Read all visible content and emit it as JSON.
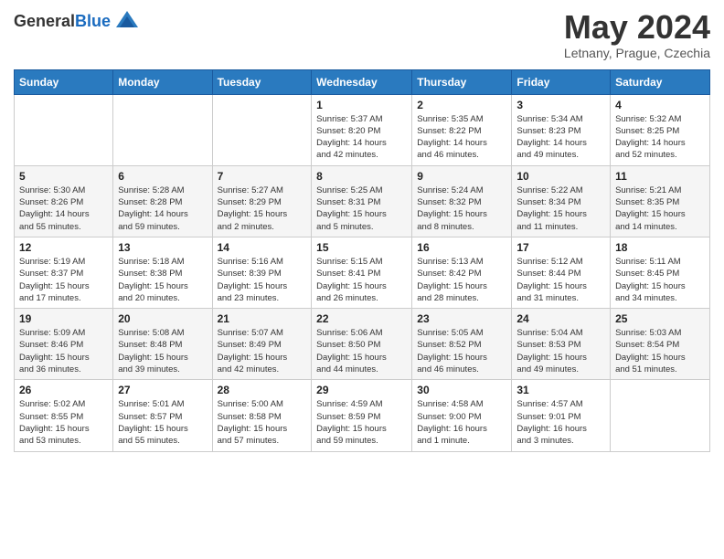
{
  "header": {
    "logo_line1": "General",
    "logo_line2": "Blue",
    "month_title": "May 2024",
    "location": "Letnany, Prague, Czechia"
  },
  "calendar": {
    "days_of_week": [
      "Sunday",
      "Monday",
      "Tuesday",
      "Wednesday",
      "Thursday",
      "Friday",
      "Saturday"
    ],
    "weeks": [
      [
        {
          "day": "",
          "info": ""
        },
        {
          "day": "",
          "info": ""
        },
        {
          "day": "",
          "info": ""
        },
        {
          "day": "1",
          "info": "Sunrise: 5:37 AM\nSunset: 8:20 PM\nDaylight: 14 hours\nand 42 minutes."
        },
        {
          "day": "2",
          "info": "Sunrise: 5:35 AM\nSunset: 8:22 PM\nDaylight: 14 hours\nand 46 minutes."
        },
        {
          "day": "3",
          "info": "Sunrise: 5:34 AM\nSunset: 8:23 PM\nDaylight: 14 hours\nand 49 minutes."
        },
        {
          "day": "4",
          "info": "Sunrise: 5:32 AM\nSunset: 8:25 PM\nDaylight: 14 hours\nand 52 minutes."
        }
      ],
      [
        {
          "day": "5",
          "info": "Sunrise: 5:30 AM\nSunset: 8:26 PM\nDaylight: 14 hours\nand 55 minutes."
        },
        {
          "day": "6",
          "info": "Sunrise: 5:28 AM\nSunset: 8:28 PM\nDaylight: 14 hours\nand 59 minutes."
        },
        {
          "day": "7",
          "info": "Sunrise: 5:27 AM\nSunset: 8:29 PM\nDaylight: 15 hours\nand 2 minutes."
        },
        {
          "day": "8",
          "info": "Sunrise: 5:25 AM\nSunset: 8:31 PM\nDaylight: 15 hours\nand 5 minutes."
        },
        {
          "day": "9",
          "info": "Sunrise: 5:24 AM\nSunset: 8:32 PM\nDaylight: 15 hours\nand 8 minutes."
        },
        {
          "day": "10",
          "info": "Sunrise: 5:22 AM\nSunset: 8:34 PM\nDaylight: 15 hours\nand 11 minutes."
        },
        {
          "day": "11",
          "info": "Sunrise: 5:21 AM\nSunset: 8:35 PM\nDaylight: 15 hours\nand 14 minutes."
        }
      ],
      [
        {
          "day": "12",
          "info": "Sunrise: 5:19 AM\nSunset: 8:37 PM\nDaylight: 15 hours\nand 17 minutes."
        },
        {
          "day": "13",
          "info": "Sunrise: 5:18 AM\nSunset: 8:38 PM\nDaylight: 15 hours\nand 20 minutes."
        },
        {
          "day": "14",
          "info": "Sunrise: 5:16 AM\nSunset: 8:39 PM\nDaylight: 15 hours\nand 23 minutes."
        },
        {
          "day": "15",
          "info": "Sunrise: 5:15 AM\nSunset: 8:41 PM\nDaylight: 15 hours\nand 26 minutes."
        },
        {
          "day": "16",
          "info": "Sunrise: 5:13 AM\nSunset: 8:42 PM\nDaylight: 15 hours\nand 28 minutes."
        },
        {
          "day": "17",
          "info": "Sunrise: 5:12 AM\nSunset: 8:44 PM\nDaylight: 15 hours\nand 31 minutes."
        },
        {
          "day": "18",
          "info": "Sunrise: 5:11 AM\nSunset: 8:45 PM\nDaylight: 15 hours\nand 34 minutes."
        }
      ],
      [
        {
          "day": "19",
          "info": "Sunrise: 5:09 AM\nSunset: 8:46 PM\nDaylight: 15 hours\nand 36 minutes."
        },
        {
          "day": "20",
          "info": "Sunrise: 5:08 AM\nSunset: 8:48 PM\nDaylight: 15 hours\nand 39 minutes."
        },
        {
          "day": "21",
          "info": "Sunrise: 5:07 AM\nSunset: 8:49 PM\nDaylight: 15 hours\nand 42 minutes."
        },
        {
          "day": "22",
          "info": "Sunrise: 5:06 AM\nSunset: 8:50 PM\nDaylight: 15 hours\nand 44 minutes."
        },
        {
          "day": "23",
          "info": "Sunrise: 5:05 AM\nSunset: 8:52 PM\nDaylight: 15 hours\nand 46 minutes."
        },
        {
          "day": "24",
          "info": "Sunrise: 5:04 AM\nSunset: 8:53 PM\nDaylight: 15 hours\nand 49 minutes."
        },
        {
          "day": "25",
          "info": "Sunrise: 5:03 AM\nSunset: 8:54 PM\nDaylight: 15 hours\nand 51 minutes."
        }
      ],
      [
        {
          "day": "26",
          "info": "Sunrise: 5:02 AM\nSunset: 8:55 PM\nDaylight: 15 hours\nand 53 minutes."
        },
        {
          "day": "27",
          "info": "Sunrise: 5:01 AM\nSunset: 8:57 PM\nDaylight: 15 hours\nand 55 minutes."
        },
        {
          "day": "28",
          "info": "Sunrise: 5:00 AM\nSunset: 8:58 PM\nDaylight: 15 hours\nand 57 minutes."
        },
        {
          "day": "29",
          "info": "Sunrise: 4:59 AM\nSunset: 8:59 PM\nDaylight: 15 hours\nand 59 minutes."
        },
        {
          "day": "30",
          "info": "Sunrise: 4:58 AM\nSunset: 9:00 PM\nDaylight: 16 hours\nand 1 minute."
        },
        {
          "day": "31",
          "info": "Sunrise: 4:57 AM\nSunset: 9:01 PM\nDaylight: 16 hours\nand 3 minutes."
        },
        {
          "day": "",
          "info": ""
        }
      ]
    ]
  }
}
